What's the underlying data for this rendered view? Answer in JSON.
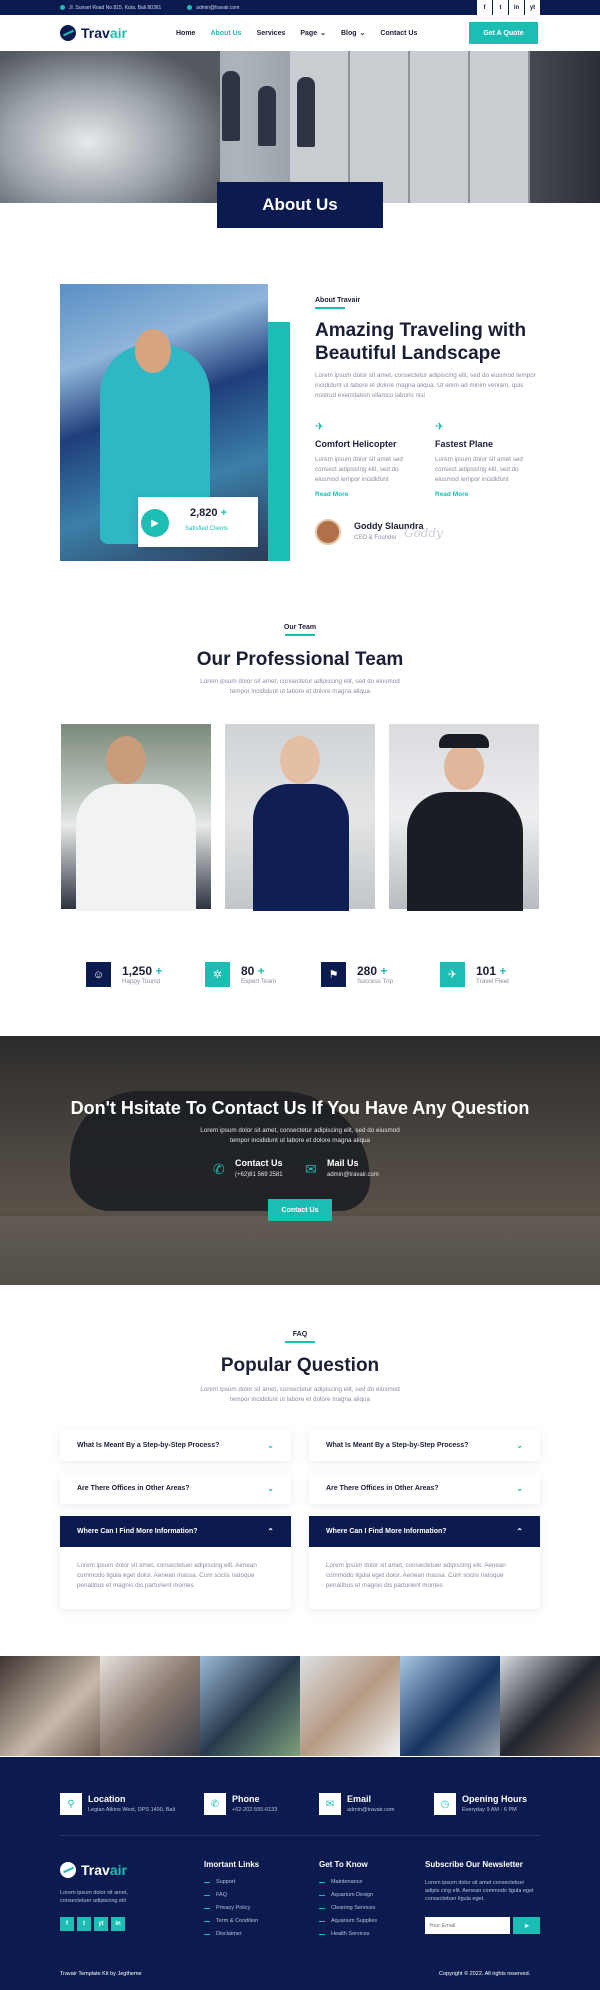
{
  "topbar": {
    "address": "Jl. Sunset Road No.815, Kuta, Bali 80361",
    "email": "admin@travair.com",
    "social": [
      "f",
      "t",
      "in",
      "yt"
    ]
  },
  "brand": {
    "part1": "Trav",
    "part2": "air"
  },
  "nav": {
    "items": [
      "Home",
      "About Us",
      "Services",
      "Page",
      "Blog",
      "Contact Us"
    ],
    "active": "About Us",
    "cta": "Get A Quote"
  },
  "hero": {
    "title": "About Us"
  },
  "about": {
    "tag": "About Travair",
    "title": "Amazing Traveling with Beautiful Landscape",
    "text": "Lorem ipsum dolor sit amet, consectetur adipiscing elit, sed do eiusmod tempor incididunt ut labore et dolore magna aliqua. Ut enim ad minim veniam, quis nostrud exercitation ullamco laboris nisi",
    "features": [
      {
        "icon": "helicopter-icon",
        "title": "Comfort Helicopter",
        "text": "Lorem ipsum dolor sit amet sed consect adipiscing elit, sed do eiusmod tempor incididunt",
        "link": "Read More"
      },
      {
        "icon": "plane-icon",
        "title": "Fastest Plane",
        "text": "Lorem ipsum dolor sit amet sed consect adipiscing elit, sed do eiusmod tempor incididunt",
        "link": "Read More"
      }
    ],
    "author": {
      "name": "Goddy Slaundra",
      "role": "CEO & Founder",
      "signature": "Goddy"
    },
    "stat": {
      "value": "2,820",
      "plus": "+",
      "label": "Satisfied Clients"
    }
  },
  "team": {
    "tag": "Our Team",
    "title": "Our Professional Team",
    "text_line1": "Lorem ipsum dolor sit amet, consectetur adipiscing elit, sed do eiusmod",
    "text_line2": "tempor incididunt ut labore et dolore magna aliqua"
  },
  "stats": [
    {
      "icon": "tourist-icon",
      "value": "1,250",
      "plus": "+",
      "label": "Happy Tourist",
      "color": "#0b1b4f"
    },
    {
      "icon": "team-icon",
      "value": "80",
      "plus": "+",
      "label": "Expert Team",
      "color": "#1cbdb3"
    },
    {
      "icon": "flag-icon",
      "value": "280",
      "plus": "+",
      "label": "Success Trip",
      "color": "#0b1b4f"
    },
    {
      "icon": "fleet-icon",
      "value": "101",
      "plus": "+",
      "label": "Travel Fleet",
      "color": "#1cbdb3"
    }
  ],
  "cta": {
    "title": "Don't Hsitate To Contact Us If You Have Any Question",
    "text_line1": "Lorem ipsum dolor sit amet, consectetur adipiscing elit, sed do eiusmod",
    "text_line2": "tempor incididunt ut labore et dolore magna aliqua",
    "contact": {
      "title": "Contact Us",
      "value": "(+62)81 569 2581"
    },
    "mail": {
      "title": "Mail Us",
      "value": "admin@travair.com"
    },
    "button": "Contact Us"
  },
  "faq": {
    "tag": "FAQ",
    "title": "Popular Question",
    "text_line1": "Lorem ipsum dolor sit amet, consectetur adipiscing elit, sed do eiusmod",
    "text_line2": "tempor incididunt ut labore et dolore magna aliqua",
    "left": [
      {
        "q": "What Is Meant By a Step-by-Step Process?"
      },
      {
        "q": "Are There Offices in Other Areas?"
      },
      {
        "q": "Where Can I Find More Information?"
      }
    ],
    "right": [
      {
        "q": "What Is Meant By a Step-by-Step Process?"
      },
      {
        "q": "Are There Offices in Other Areas?"
      },
      {
        "q": "Where Can I Find More Information?"
      }
    ],
    "answer": "Lorem ipsum dolor sit amet, consectetuer adipiscing elit. Aenean commodo ligula eget dolor. Aenean massa. Cum sociis natoque penatibus et magnis dis parturient montes"
  },
  "footer": {
    "info": [
      {
        "icon": "location-icon",
        "title": "Location",
        "text": "Legian Atkins West, DPS 1490, Bali"
      },
      {
        "icon": "phone-icon",
        "title": "Phone",
        "text": "+62-202-555-0133"
      },
      {
        "icon": "email-icon",
        "title": "Email",
        "text": "admin@travair.com"
      },
      {
        "icon": "clock-icon",
        "title": "Opening Hours",
        "text": "Everyday 9 AM - 6 PM"
      }
    ],
    "about": "Lorem ipsum dolor sit amet, consectetuer adipiscing elit",
    "important": {
      "title": "Imortant Links",
      "items": [
        "Support",
        "FAQ",
        "Privacy Policy",
        "Term & Condition",
        "Disclaimer"
      ]
    },
    "know": {
      "title": "Get To Know",
      "items": [
        "Maintenance",
        "Aquarium Design",
        "Cleaning Services",
        "Aquarium Supplies",
        "Health Services"
      ]
    },
    "newsletter": {
      "title": "Subscribe Our Newsletter",
      "text": "Lorem ipsum dolor sit amet consectetuer adipis cing elit. Aenean commodo ligula eget consectetuer ligula eget.",
      "placeholder": "Your Email"
    },
    "credit": "Travair Template Kit by Jegtheme",
    "copyright": "Copyright © 2022. All rights reserved."
  }
}
